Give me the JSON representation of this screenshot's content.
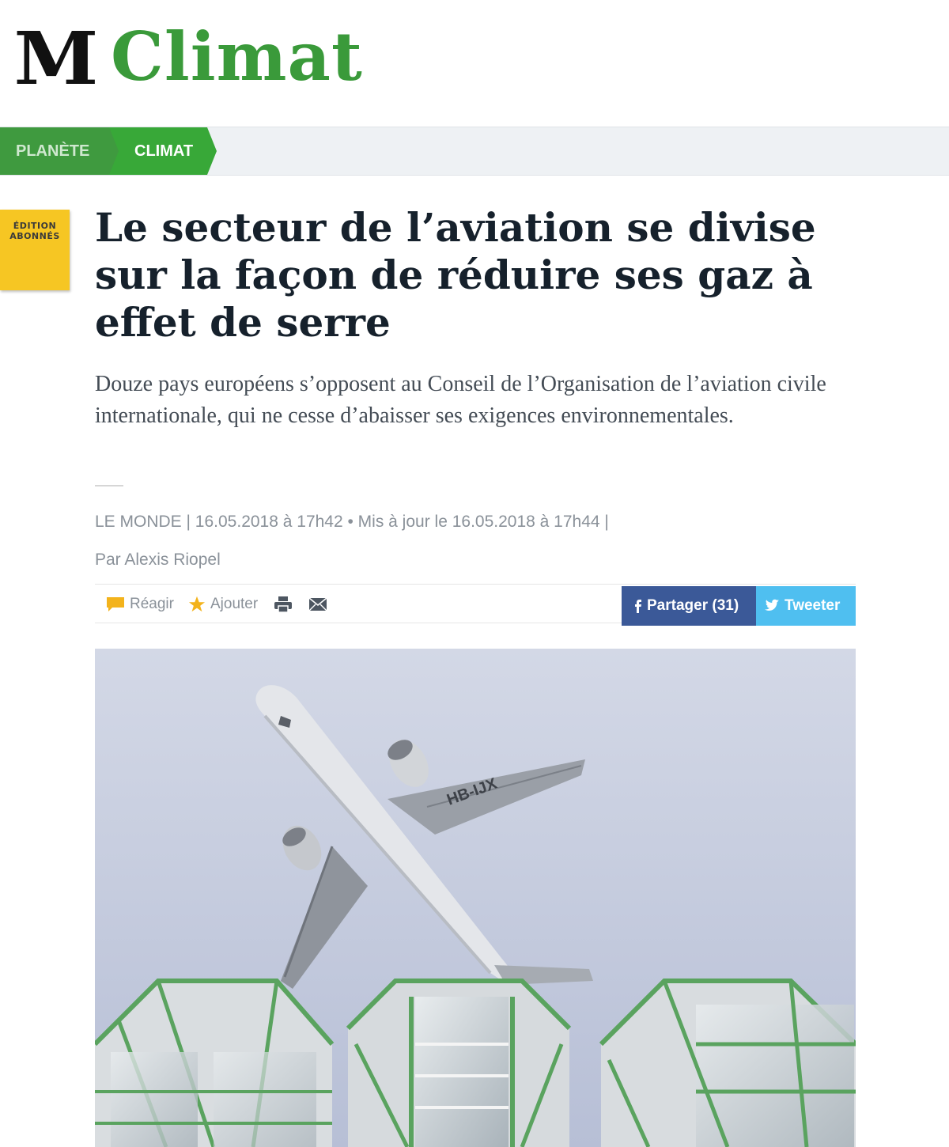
{
  "header": {
    "logo": "M",
    "section": "Climat"
  },
  "breadcrumb": {
    "items": [
      {
        "label": "PLANÈTE"
      },
      {
        "label": "CLIMAT"
      }
    ]
  },
  "badge": {
    "line1": "ÉDITION",
    "line2": "ABONNÉS"
  },
  "article": {
    "title": "Le secteur de l’aviation se divise sur la façon de réduire ses gaz à effet de serre",
    "standfirst": "Douze pays européens s’opposent au Conseil de l’Organisation de l’aviation civile internationale, qui ne cesse d’abaisser ses exigences environnementales.",
    "dateline": "LE MONDE | 16.05.2018 à 17h42 • Mis à jour le 16.05.2018 à 17h44 |",
    "byline": "Par Alexis Riopel"
  },
  "toolbar": {
    "react_label": "Réagir",
    "add_label": "Ajouter",
    "share_facebook": "Partager (31)",
    "share_twitter": "Tweeter"
  },
  "photo": {
    "registration": "HB-IJX"
  },
  "colors": {
    "brand_green": "#3a9a3a",
    "badge_yellow": "#f6c623",
    "facebook": "#3b5998",
    "twitter": "#4fbff0"
  }
}
